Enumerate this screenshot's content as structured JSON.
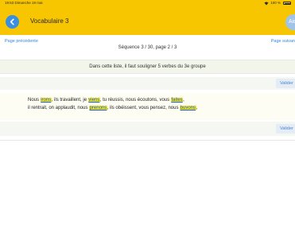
{
  "status_bar": {
    "time_date": "19:53  Dimanche 19 mai",
    "battery": "100 %"
  },
  "header": {
    "title": "Vocabulaire 3",
    "help_label": "Aid"
  },
  "navigation": {
    "prev_label": "Page précédente",
    "next_label": "Page suivan",
    "sequence_label": "Séquence 3 / 30, page 2 / 3"
  },
  "instruction": "Dans cette liste, il faut souligner 5 verbes du 3e groupe",
  "validate_label": "Valider",
  "exercise": {
    "line1": [
      {
        "text": "Nous ",
        "highlight": false
      },
      {
        "text": "irons",
        "highlight": true
      },
      {
        "text": ", ils travaillent, je ",
        "highlight": false
      },
      {
        "text": "viens",
        "highlight": true
      },
      {
        "text": ", tu réussis, nous écoutons, vous ",
        "highlight": false
      },
      {
        "text": "faites",
        "highlight": true
      },
      {
        "text": ",",
        "highlight": false
      }
    ],
    "line2": [
      {
        "text": "il rentrait, on applaudit, nous ",
        "highlight": false
      },
      {
        "text": "prenons",
        "highlight": true
      },
      {
        "text": ", ils obéissent, vous pensez, nous ",
        "highlight": false
      },
      {
        "text": "buvons",
        "highlight": true
      },
      {
        "text": ",",
        "highlight": false
      }
    ]
  },
  "colors": {
    "header_yellow": "#f7c600",
    "link_blue": "#3a86d6",
    "highlight_yellow": "#f6ec34"
  }
}
